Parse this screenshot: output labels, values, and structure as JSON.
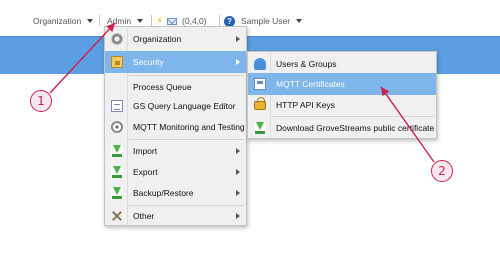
{
  "toolbar": {
    "organization_label": "Organization",
    "admin_label": "Admin",
    "counts_label": "(0,4,0)",
    "user_label": "Sample User",
    "help_symbol": "?"
  },
  "admin_menu": {
    "items": [
      {
        "label": "Organization",
        "icon": "gear-icon",
        "has_submenu": true
      },
      {
        "label": "Security",
        "icon": "lock-folder-icon",
        "has_submenu": true,
        "active": true
      },
      {
        "label": "Process Queue",
        "icon": "",
        "has_submenu": false
      },
      {
        "label": "GS Query Language Editor",
        "icon": "document-icon",
        "has_submenu": false
      },
      {
        "label": "MQTT Monitoring and Testing",
        "icon": "target-icon",
        "has_submenu": false
      },
      {
        "label": "Import",
        "icon": "download-icon",
        "has_submenu": true
      },
      {
        "label": "Export",
        "icon": "download-icon",
        "has_submenu": true
      },
      {
        "label": "Backup/Restore",
        "icon": "download-icon",
        "has_submenu": true
      },
      {
        "label": "Other",
        "icon": "tools-icon",
        "has_submenu": true
      }
    ]
  },
  "security_submenu": {
    "items": [
      {
        "label": "Users & Groups",
        "icon": "users-icon"
      },
      {
        "label": "MQTT Certificates",
        "icon": "certificate-icon",
        "active": true
      },
      {
        "label": "HTTP API Keys",
        "icon": "lock-icon"
      },
      {
        "label": "Download GroveStreams public certificate",
        "icon": "download-icon"
      }
    ]
  },
  "annotations": {
    "badge_1": "1",
    "badge_2": "2",
    "color": "#d0204a"
  },
  "colors": {
    "banner": "#5b9ee3",
    "menu_highlight": "#7eb5ea"
  }
}
